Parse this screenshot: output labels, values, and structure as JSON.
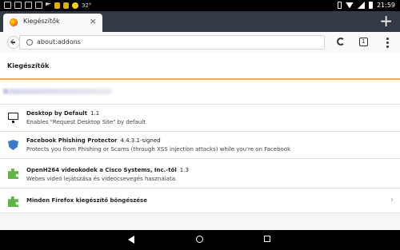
{
  "statusbar": {
    "temp": "32°",
    "time": "21:59"
  },
  "tab": {
    "title": "Kiegészítők"
  },
  "urlbar": {
    "value": "about:addons"
  },
  "tabs_count": "1",
  "page": {
    "heading": "Kiegészítők"
  },
  "addons": [
    {
      "name": "Desktop by Default",
      "version": "1.1",
      "description": "Enables \"Request Desktop Site\" by default",
      "icon": "monitor-icon"
    },
    {
      "name": "Facebook Phishing Protector",
      "version": "4.4.3.1-signed",
      "description": "Protects you from Phishing or Scams (through XSS injection attacks) while you're on Facebook",
      "icon": "shield-icon"
    },
    {
      "name": "OpenH264 videokodek a Cisco Systems, Inc.-től",
      "version": "1.3",
      "description": "Webes videó lejátszása és videocsevegés használata.",
      "icon": "puzzle-icon"
    }
  ],
  "browse_all": {
    "label": "Minden Firefox kiegészítő böngészése",
    "icon": "puzzle-icon",
    "chevron": "chevron-right-icon"
  },
  "colors": {
    "accent_line": "#f4b04a",
    "tabstrip": "#333a44"
  }
}
